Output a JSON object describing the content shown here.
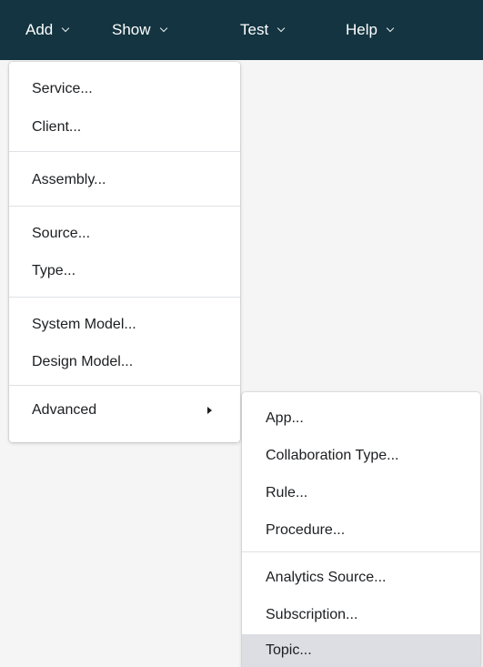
{
  "menubar": {
    "items": [
      {
        "label": "Add"
      },
      {
        "label": "Show"
      },
      {
        "label": "Test"
      },
      {
        "label": "Help"
      }
    ]
  },
  "add_menu": {
    "groups": [
      [
        "Service...",
        "Client..."
      ],
      [
        "Assembly..."
      ],
      [
        "Source...",
        "Type..."
      ],
      [
        "System Model...",
        "Design Model..."
      ],
      [
        "Advanced"
      ]
    ]
  },
  "advanced_menu": {
    "groups": [
      [
        "App...",
        "Collaboration Type...",
        "Rule...",
        "Procedure..."
      ],
      [
        "Analytics Source...",
        "Subscription...",
        "Topic..."
      ]
    ],
    "highlighted_item": "Topic..."
  },
  "colors": {
    "menubar_bg": "#133440",
    "highlight_bg": "#dcdee3"
  }
}
